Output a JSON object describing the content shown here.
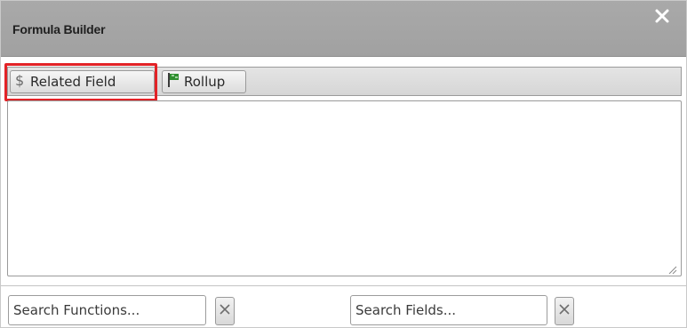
{
  "dialog": {
    "title": "Formula Builder",
    "close_icon": "close-icon"
  },
  "toolbar": {
    "related_field_label": "Related Field",
    "related_field_icon": "dollar-icon",
    "rollup_label": "Rollup",
    "rollup_icon": "flag-icon",
    "highlight_color": "#e22327"
  },
  "editor": {
    "value": ""
  },
  "search": {
    "functions_placeholder": "Search Functions...",
    "fields_placeholder": "Search Fields...",
    "clear_icon": "clear-x-icon"
  }
}
